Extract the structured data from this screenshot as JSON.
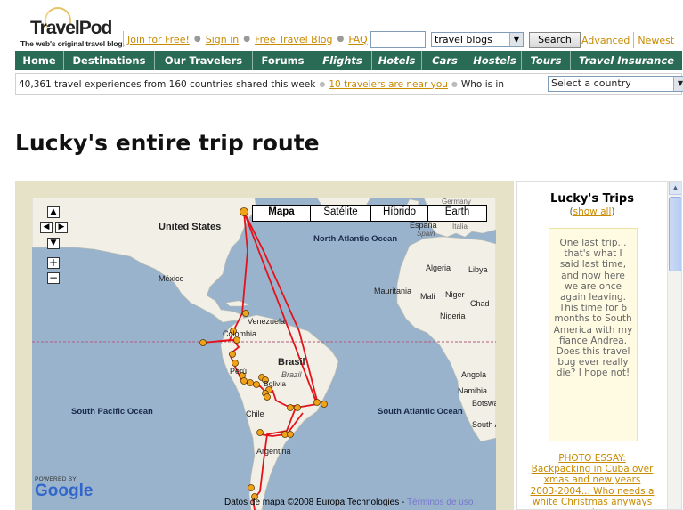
{
  "logo": {
    "name": "TravelPod",
    "tagline": "The web's original travel blog."
  },
  "header": {
    "links": [
      "Join for Free!",
      "Sign in",
      "Free Travel Blog",
      "FAQ"
    ],
    "search_value": "",
    "blog_select": "travel blogs",
    "search_button": "Search",
    "advanced": "Advanced",
    "newest": "Newest"
  },
  "nav": {
    "items": [
      {
        "label": "Home"
      },
      {
        "label": "Destinations"
      },
      {
        "label": "Our Travelers"
      },
      {
        "label": "Forums"
      },
      {
        "label": "Flights"
      },
      {
        "label": "Hotels"
      },
      {
        "label": "Cars"
      },
      {
        "label": "Hostels"
      },
      {
        "label": "Tours"
      },
      {
        "label": "Travel Insurance"
      }
    ]
  },
  "infobar": {
    "stats": "40,361 travel experiences from 160 countries shared this week",
    "near_link": "10 travelers are near you",
    "who_is_in": "Who is in",
    "country_select": "Select a country"
  },
  "page": {
    "title": "Lucky's entire trip route"
  },
  "map": {
    "types": [
      "Mapa",
      "Satélite",
      "Híbrido",
      "Earth"
    ],
    "labels": {
      "germany": "Germany",
      "united_states": "United States",
      "espana": "España",
      "espana_sub": "Spain",
      "italia": "Italia",
      "north_atlantic": "North Atlantic Ocean",
      "algeria": "Algeria",
      "libya": "Libya",
      "mexico": "México",
      "mauritania": "Mauritania",
      "mali": "Mali",
      "niger": "Niger",
      "chad": "Chad",
      "nigeria": "Nigeria",
      "venezuela": "Venezuela",
      "colombia": "Colombia",
      "peru": "Perú",
      "brasil": "Brasil",
      "brazil": "Brazil",
      "bolivia": "Bolivia",
      "angola": "Angola",
      "namibia": "Namibia",
      "botswana": "Botswana",
      "chile": "Chile",
      "south_pacific": "South Pacific Ocean",
      "south_atlantic": "South Atlantic Ocean",
      "south_africa": "South Africa",
      "argentina": "Argentina"
    },
    "powered_by": "POWERED BY",
    "google": "Google",
    "copyright": "Datos de mapa ©2008 Europa Technologies -",
    "terms": "Términos de uso"
  },
  "trips": {
    "title": "Lucky's Trips",
    "show_all": "show all",
    "card_text": "One last trip... that's what I said last time, and now here we are once again leaving. This time for 6 months to South America with my fiance Andrea. Does this travel bug ever really die? I hope not!",
    "essay_link": "PHOTO ESSAY: Backpacking in Cuba over xmas and new years 2003-2004... Who needs a white Christmas anyways :)"
  },
  "colors": {
    "nav_bg": "#2a6b55",
    "link": "#c88a00",
    "ocean": "#99b3cc",
    "land": "#f2efe6",
    "route": "#e3131b"
  }
}
